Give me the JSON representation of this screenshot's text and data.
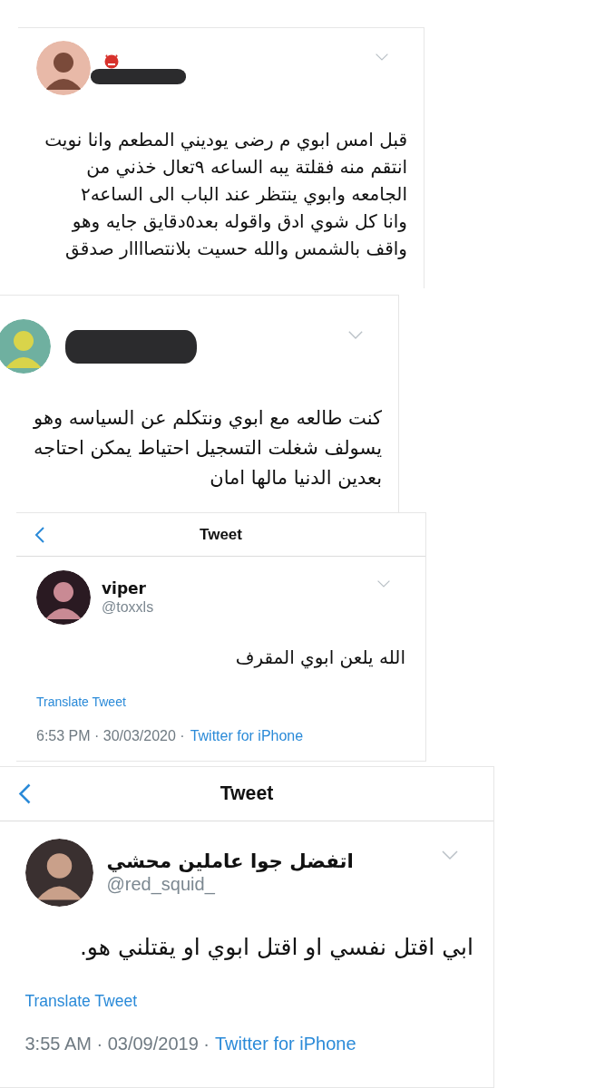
{
  "panels": [
    {
      "kind": "feed",
      "name_redacted": true,
      "text": "قبل امس ابوي م رضى يوديني المطعم وانا نويت\nانتقم منه فقلتة يبه الساعه ٩تعال خذني من\nالجامعه وابوي ينتظر عند الباب الى الساعه٢\nوانا كل شوي ادق واقوله بعد٥دقايق جايه وهو\nواقف بالشمس والله حسيت بلانتصاااار صدقق"
    },
    {
      "kind": "feed",
      "name_redacted": true,
      "text": "كنت طالعه مع ابوي ونتكلم عن السياسه وهو\nيسولف شغلت التسجيل احتياط يمكن احتاجه\nبعدين الدنيا مالها امان"
    },
    {
      "kind": "detail",
      "header": "Tweet",
      "name": "viper",
      "handle": "@toxxls",
      "text": "الله يلعن ابوي المقرف",
      "translate": "Translate Tweet",
      "time": "6:53 PM · 30/03/2020 ·",
      "source": "Twitter for iPhone"
    },
    {
      "kind": "detail",
      "header": "Tweet",
      "name": "اتفضل جوا عاملين محشي",
      "handle": "@red_squid_",
      "text": "ابي اقتل نفسي او اقتل ابوي او يقتلني هو.",
      "translate": "Translate Tweet",
      "time": "3:55 AM · 03/09/2019 ·",
      "source": "Twitter for iPhone"
    }
  ]
}
